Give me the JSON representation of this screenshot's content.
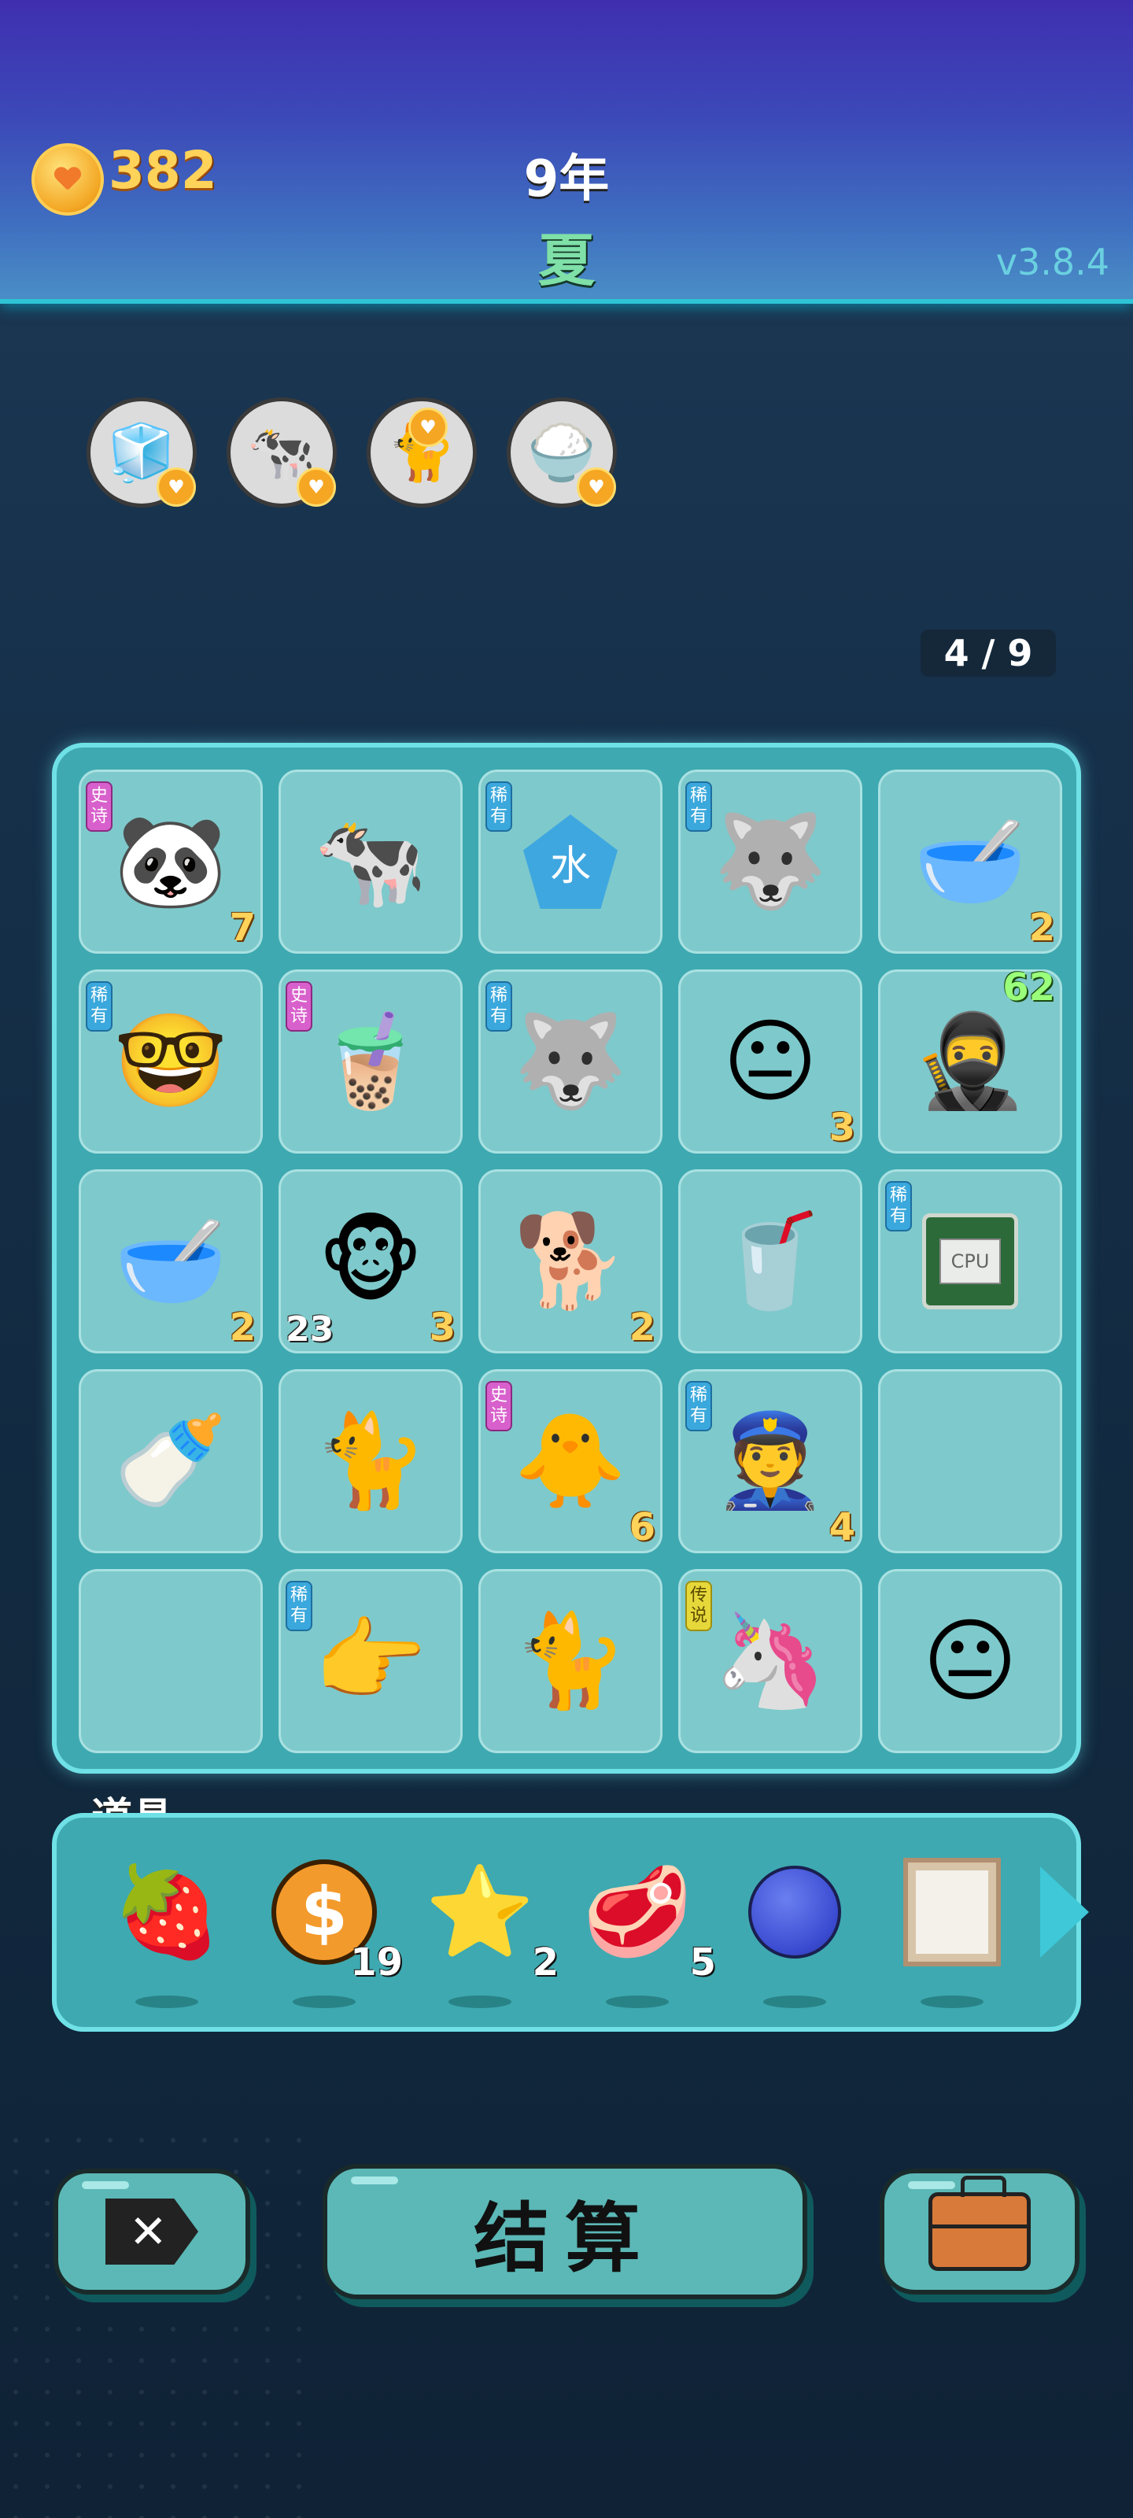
{
  "header": {
    "coins": "382",
    "coin_icon": "heart-coin-icon",
    "year": "9年",
    "season": "夏",
    "version": "v3.8.4"
  },
  "bonuses": [
    {
      "icon": "sugar-cubes-icon",
      "emoji": "🧊"
    },
    {
      "icon": "cow-pair-icon",
      "emoji": "🐄"
    },
    {
      "icon": "cat-pair-icon",
      "emoji": "🐈"
    },
    {
      "icon": "rice-bowl-icon",
      "emoji": "🍚"
    }
  ],
  "page": "4 / 9",
  "grid": [
    {
      "name": "panda",
      "emoji": "🐼",
      "rarity": "史诗",
      "rtype": "epic",
      "count": "7"
    },
    {
      "name": "cow",
      "emoji": "🐄",
      "rarity": "",
      "rtype": "",
      "count": ""
    },
    {
      "name": "water-gem",
      "emoji": "水",
      "rarity": "稀有",
      "rtype": "rare",
      "count": ""
    },
    {
      "name": "husky",
      "emoji": "🐺",
      "rarity": "稀有",
      "rtype": "rare",
      "count": ""
    },
    {
      "name": "bowl",
      "emoji": "🥣",
      "rarity": "",
      "rtype": "",
      "count": "2"
    },
    {
      "name": "glasses-boy",
      "emoji": "🤓",
      "rarity": "稀有",
      "rtype": "rare",
      "count": ""
    },
    {
      "name": "bubble-tea-large",
      "emoji": "🧋",
      "rarity": "史诗",
      "rtype": "epic",
      "count": ""
    },
    {
      "name": "husky-2",
      "emoji": "🐺",
      "rarity": "稀有",
      "rtype": "rare",
      "count": ""
    },
    {
      "name": "man-face",
      "emoji": "😐",
      "rarity": "",
      "rtype": "",
      "count": "3"
    },
    {
      "name": "thief",
      "emoji": "🥷",
      "rarity": "",
      "rtype": "",
      "count": "",
      "count_top": "62"
    },
    {
      "name": "bowl-2",
      "emoji": "🥣",
      "rarity": "",
      "rtype": "",
      "count": "2"
    },
    {
      "name": "monkey",
      "emoji": "🐵",
      "rarity": "",
      "rtype": "",
      "count": "3",
      "count_left": "23"
    },
    {
      "name": "brown-dog",
      "emoji": "🐕",
      "rarity": "",
      "rtype": "",
      "count": "2"
    },
    {
      "name": "bubble-tea-small",
      "emoji": "🥤",
      "rarity": "",
      "rtype": "",
      "count": ""
    },
    {
      "name": "cpu",
      "emoji": "CPU",
      "rarity": "稀有",
      "rtype": "rare",
      "count": ""
    },
    {
      "name": "milk",
      "emoji": "🍼",
      "rarity": "",
      "rtype": "",
      "count": ""
    },
    {
      "name": "cat",
      "emoji": "🐈",
      "rarity": "",
      "rtype": "",
      "count": ""
    },
    {
      "name": "chick",
      "emoji": "🐥",
      "rarity": "史诗",
      "rtype": "epic",
      "count": "6"
    },
    {
      "name": "police",
      "emoji": "👮",
      "rarity": "稀有",
      "rtype": "rare",
      "count": "4"
    },
    {
      "name": "empty-1",
      "emoji": "",
      "rarity": "",
      "rtype": "",
      "count": ""
    },
    {
      "name": "empty-2",
      "emoji": "",
      "rarity": "",
      "rtype": "",
      "count": ""
    },
    {
      "name": "pointing-hand",
      "emoji": "👉",
      "rarity": "稀有",
      "rtype": "rare",
      "count": ""
    },
    {
      "name": "cat-2",
      "emoji": "🐈",
      "rarity": "",
      "rtype": "",
      "count": ""
    },
    {
      "name": "unicorn",
      "emoji": "🦄",
      "rarity": "传说",
      "rtype": "legend",
      "count": ""
    },
    {
      "name": "man-face-2",
      "emoji": "😐",
      "rarity": "",
      "rtype": "",
      "count": ""
    }
  ],
  "items_section": {
    "label": "道具",
    "items": [
      {
        "name": "bayberry",
        "emoji": "🍓",
        "count": ""
      },
      {
        "name": "dollar-coin",
        "emoji": "$",
        "count": "19"
      },
      {
        "name": "star",
        "emoji": "⭐",
        "count": "2"
      },
      {
        "name": "liver",
        "emoji": "🥩",
        "count": "5"
      },
      {
        "name": "blueberry",
        "emoji": "🫐",
        "count": ""
      },
      {
        "name": "frame",
        "emoji": "🖼",
        "count": ""
      }
    ],
    "next_icon": "chevron-right-icon"
  },
  "buttons": {
    "exit_icon": "exit-icon",
    "settle_label": "结算",
    "bag_icon": "briefcase-icon"
  }
}
